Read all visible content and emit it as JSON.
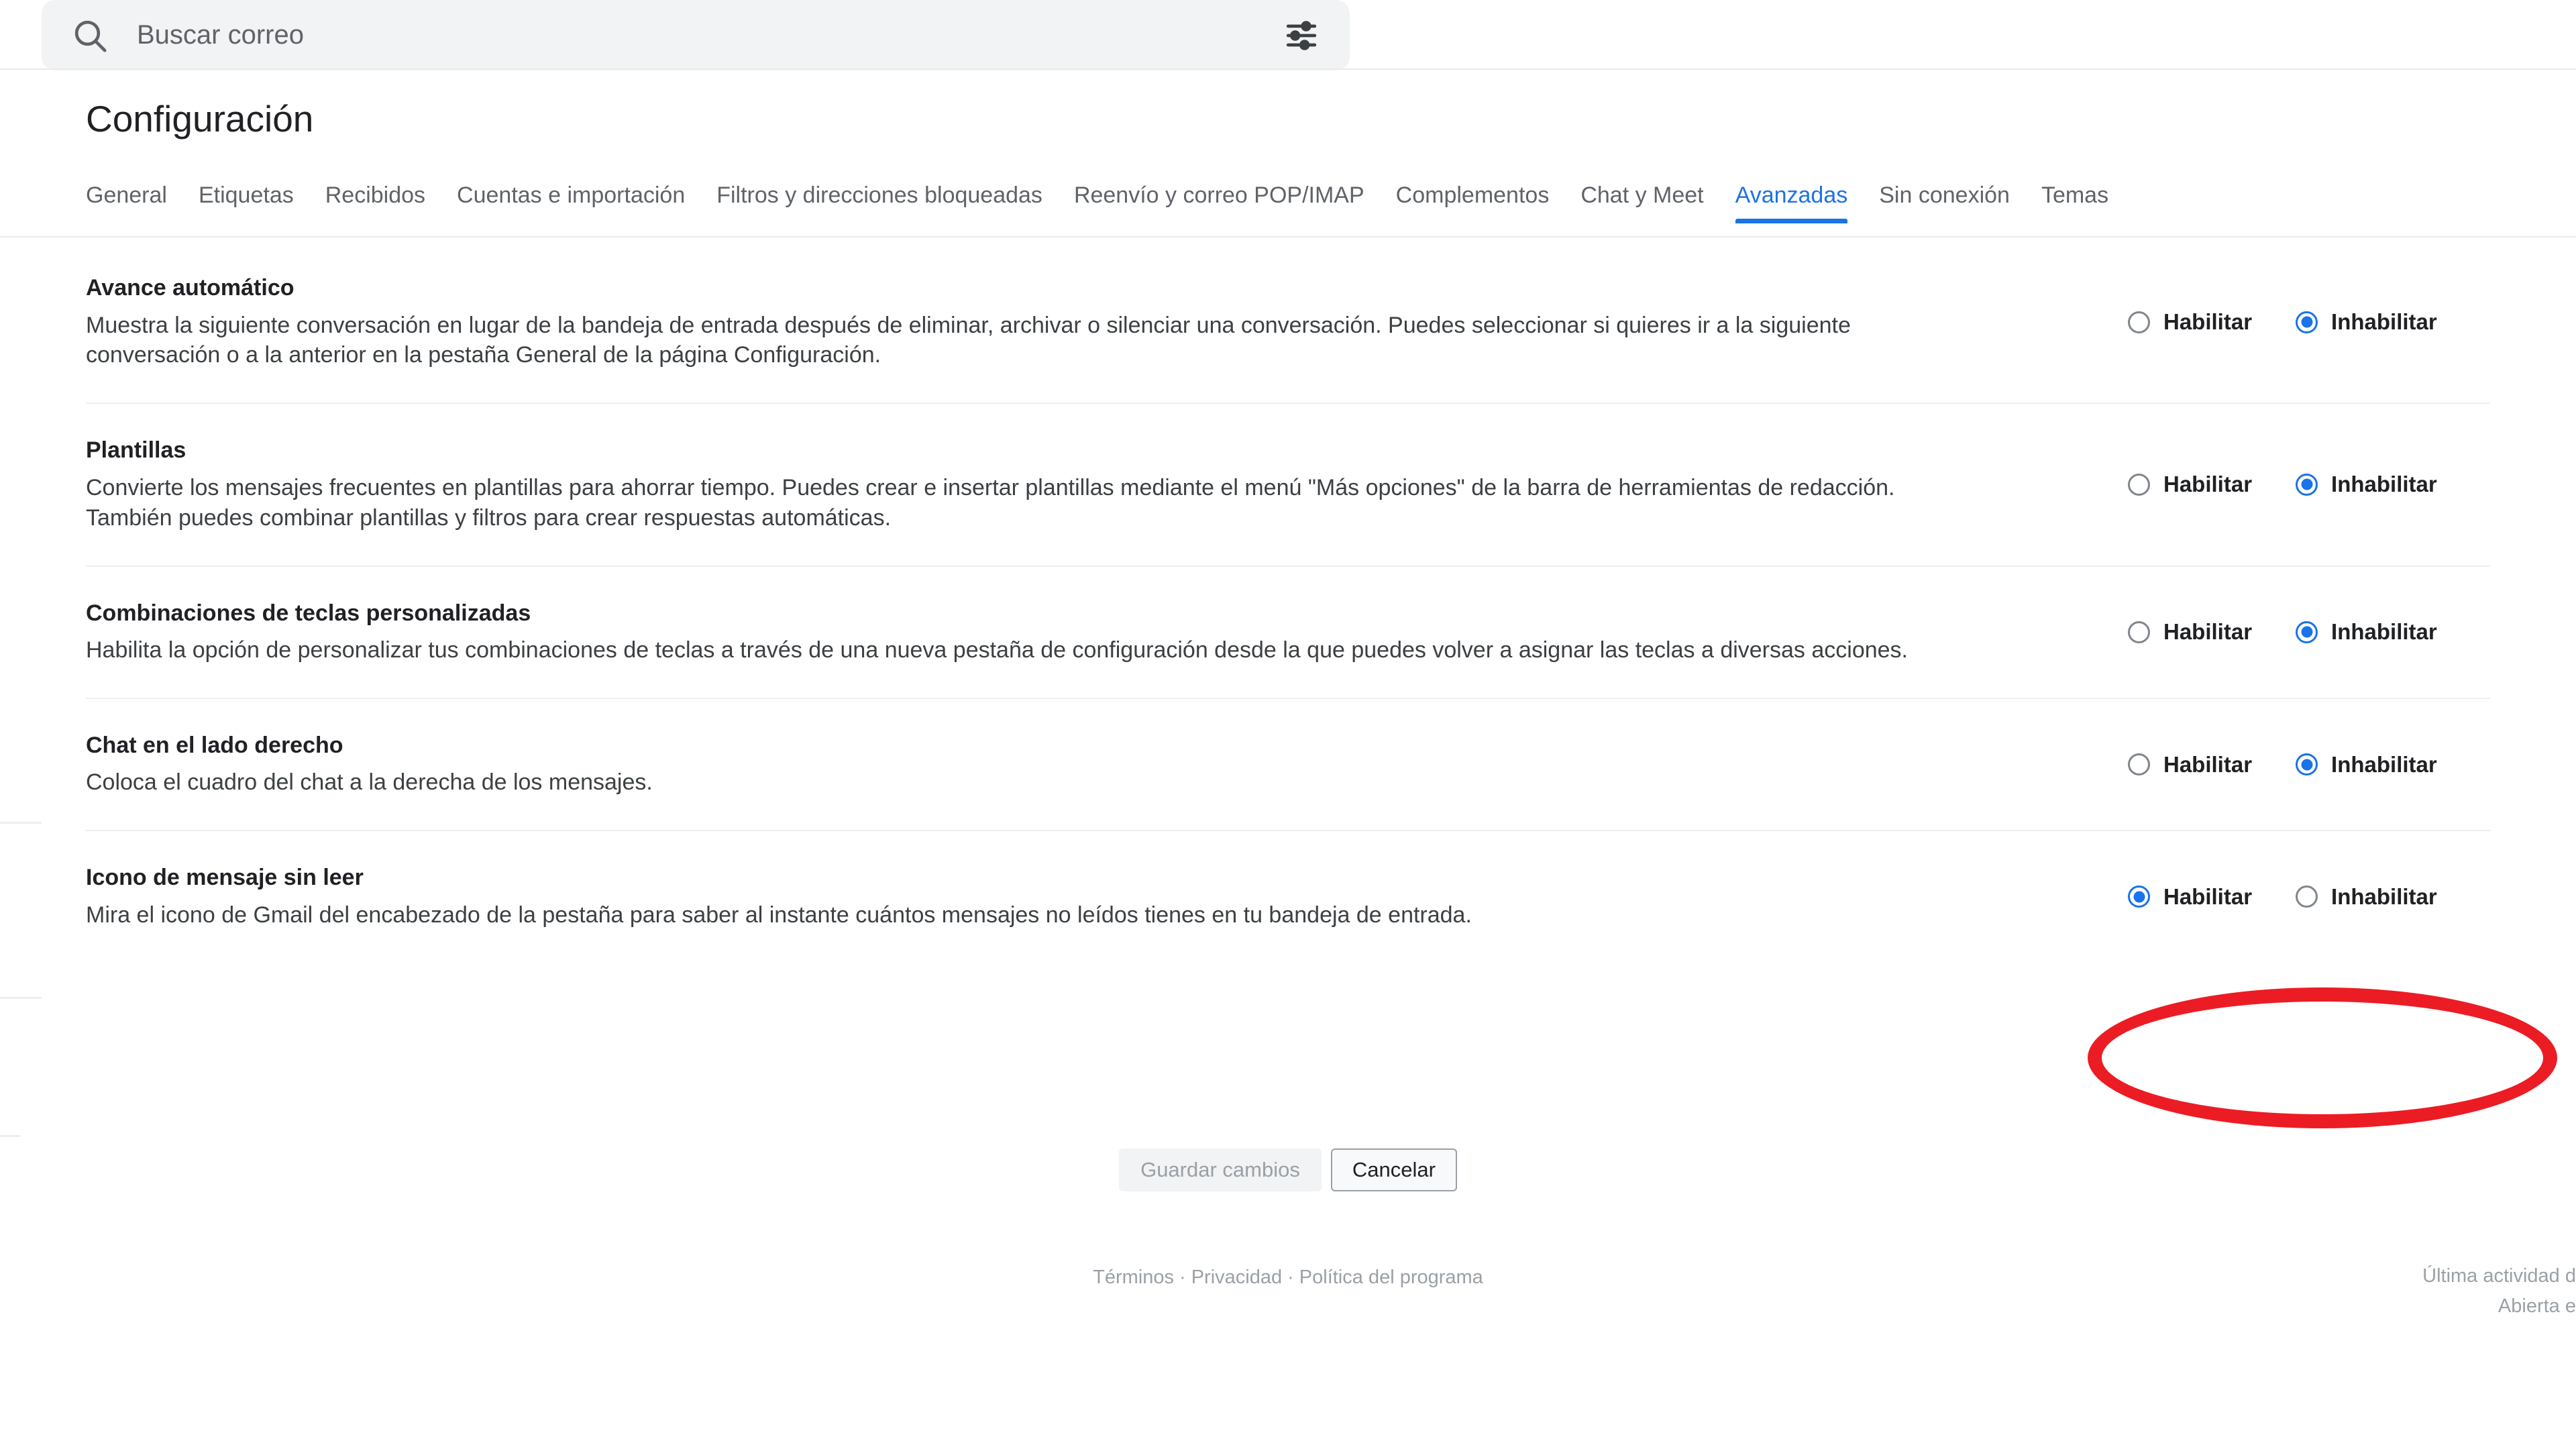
{
  "search": {
    "placeholder": "Buscar correo",
    "value": "",
    "icon": "search-icon",
    "options_icon": "tune-icon"
  },
  "page": {
    "title": "Configuración"
  },
  "tabs": [
    {
      "label": "General",
      "active": false
    },
    {
      "label": "Etiquetas",
      "active": false
    },
    {
      "label": "Recibidos",
      "active": false
    },
    {
      "label": "Cuentas e importación",
      "active": false
    },
    {
      "label": "Filtros y direcciones bloqueadas",
      "active": false
    },
    {
      "label": "Reenvío y correo POP/IMAP",
      "active": false
    },
    {
      "label": "Complementos",
      "active": false
    },
    {
      "label": "Chat y Meet",
      "active": false
    },
    {
      "label": "Avanzadas",
      "active": true
    },
    {
      "label": "Sin conexión",
      "active": false
    },
    {
      "label": "Temas",
      "active": false
    }
  ],
  "settings_rows": [
    {
      "title": "Avance automático",
      "description": "Muestra la siguiente conversación en lugar de la bandeja de entrada después de eliminar, archivar o silenciar una conversación. Puedes seleccionar si quieres ir a la siguiente conversación o a la anterior en la pestaña General de la página Configuración.",
      "enable_label": "Habilitar",
      "disable_label": "Inhabilitar",
      "selected": "disable"
    },
    {
      "title": "Plantillas",
      "description": "Convierte los mensajes frecuentes en plantillas para ahorrar tiempo. Puedes crear e insertar plantillas mediante el menú \"Más opciones\" de la barra de herramientas de redacción. También puedes combinar plantillas y filtros para crear respuestas automáticas.",
      "enable_label": "Habilitar",
      "disable_label": "Inhabilitar",
      "selected": "disable"
    },
    {
      "title": "Combinaciones de teclas personalizadas",
      "description": "Habilita la opción de personalizar tus combinaciones de teclas a través de una nueva pestaña de configuración desde la que puedes volver a asignar las teclas a diversas acciones.",
      "enable_label": "Habilitar",
      "disable_label": "Inhabilitar",
      "selected": "disable"
    },
    {
      "title": "Chat en el lado derecho",
      "description": "Coloca el cuadro del chat a la derecha de los mensajes.",
      "enable_label": "Habilitar",
      "disable_label": "Inhabilitar",
      "selected": "disable"
    },
    {
      "title": "Icono de mensaje sin leer",
      "description": "Mira el icono de Gmail del encabezado de la pestaña para saber al instante cuántos mensajes no leídos tienes en tu bandeja de entrada.",
      "enable_label": "Habilitar",
      "disable_label": "Inhabilitar",
      "selected": "enable",
      "annotated": true
    }
  ],
  "actions": {
    "save_label": "Guardar cambios",
    "save_disabled": true,
    "cancel_label": "Cancelar"
  },
  "footer": {
    "terms": "Términos",
    "privacy": "Privacidad",
    "program_policy": "Política del programa",
    "separator": "·",
    "last_activity": "Última actividad d",
    "opened_in": "Abierta e"
  },
  "annotation": {
    "type": "oval",
    "color": "#ec1c24",
    "target": "icono-de-mensaje-sin-leer-radio-group"
  },
  "colors": {
    "accent": "#1a73e8",
    "text_primary": "#202124",
    "text_secondary": "#5f6368",
    "divider": "#eceff1",
    "search_bg": "#f1f3f4",
    "annotation_red": "#ec1c24"
  }
}
